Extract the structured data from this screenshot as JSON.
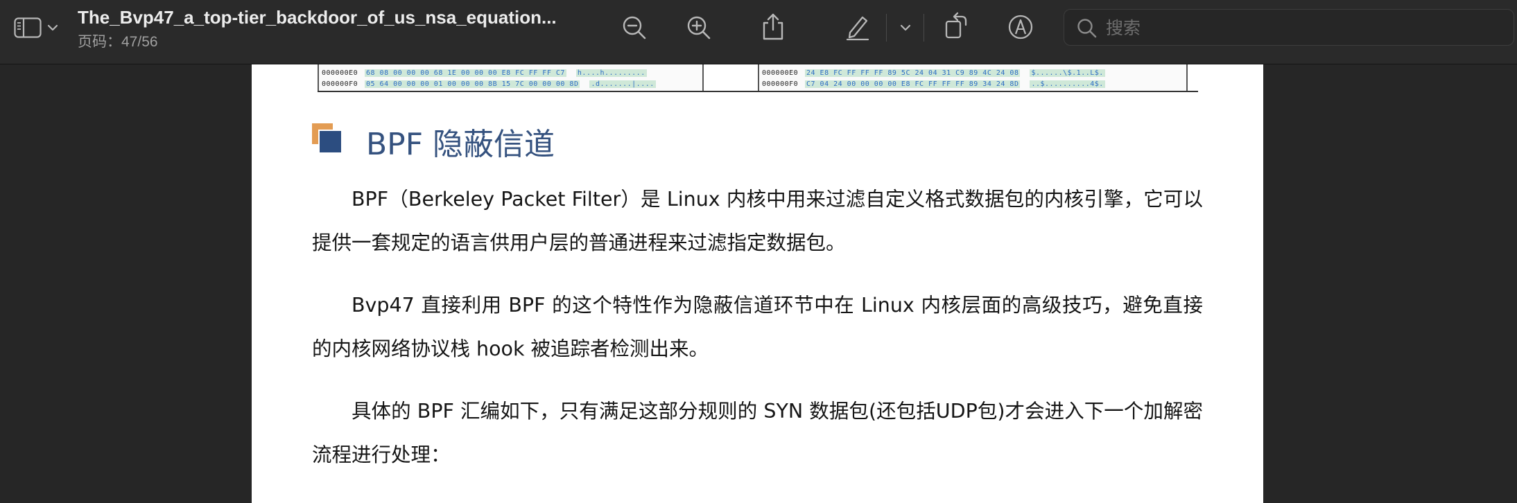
{
  "toolbar": {
    "document_title": "The_Bvp47_a_top-tier_backdoor_of_us_nsa_equation...",
    "page_indicator": "页码：47/56",
    "search_placeholder": "搜索",
    "icons": [
      "sidebar-icon",
      "chevron-down-icon",
      "zoom-out-icon",
      "zoom-in-icon",
      "share-icon",
      "highlight-pen-icon",
      "chevron-down-icon",
      "rotate-icon",
      "markup-icon",
      "search-icon"
    ]
  },
  "page": {
    "hex_dump": {
      "left_panel": [
        {
          "addr": "000000E0",
          "bytes": "68 08 00 00 00 68 1E 00 00 00 E8 FC FF FF C7",
          "ascii": "h....h........."
        },
        {
          "addr": "000000F0",
          "bytes": "05 64 00 00 00 01 00 00 00 8B 15 7C 00 00 00 8D",
          "ascii": ".d.......|...."
        }
      ],
      "right_panel": [
        {
          "addr": "000000E0",
          "bytes": "24 E8 FC FF FF FF 89 5C 24 04 31 C9 89 4C 24 08",
          "ascii": "$......\\$.1..L$."
        },
        {
          "addr": "000000F0",
          "bytes": "C7 04 24 00 00 00 00 E8 FC FF FF FF 89 34 24 8D",
          "ascii": "..$..........4$."
        }
      ]
    },
    "heading": "BPF 隐蔽信道",
    "paragraphs": [
      "BPF（Berkeley Packet Filter）是 Linux 内核中用来过滤自定义格式数据包的内核引擎，它可以提供一套规定的语言供用户层的普通进程来过滤指定数据包。",
      "Bvp47 直接利用 BPF 的这个特性作为隐蔽信道环节中在 Linux 内核层面的高级技巧，避免直接的内核网络协议栈 hook 被追踪者检测出来。",
      "具体的 BPF 汇编如下，只有满足这部分规则的 SYN 数据包(还包括UDP包)才会进入下一个加解密流程进行处理："
    ]
  },
  "colors": {
    "toolbar_bg": "#2a2a2a",
    "window_bg": "#262626",
    "heading_blue": "#35527f",
    "accent_orange": "#e39c53",
    "accent_navy": "#2c4d80"
  }
}
